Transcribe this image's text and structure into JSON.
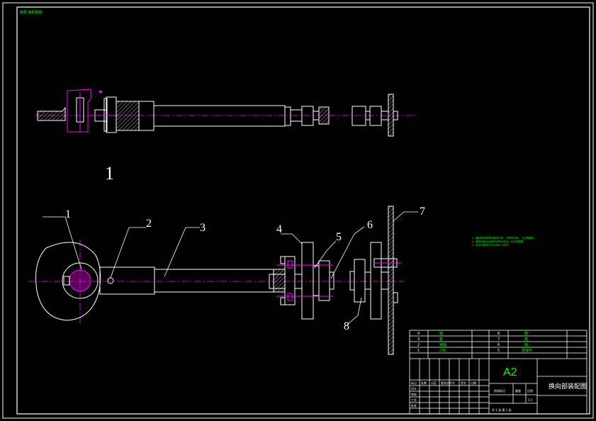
{
  "header": {
    "title_tag": "装配-装配图纸"
  },
  "view_label": "1",
  "part_callouts": [
    "1",
    "2",
    "3",
    "4",
    "5",
    "6",
    "7",
    "8"
  ],
  "tech_notes": [
    "1. 装配前所有零件清洗干净，不得有毛刺、飞边等缺陷",
    "2. 装配后各运动部件应转动灵活，无卡滞现象",
    "3. 未注公差按GB/T1804-m执行"
  ],
  "bom": [
    {
      "no": "4",
      "name": "轴"
    },
    {
      "no": "3",
      "name": "套"
    },
    {
      "no": "2",
      "name": "销轴"
    },
    {
      "no": "1",
      "name": "凸轮"
    },
    {
      "no": "8",
      "name": "键"
    },
    {
      "no": "7",
      "name": "盘"
    },
    {
      "no": "6",
      "name": "轴"
    },
    {
      "no": "5",
      "name": "连接件"
    }
  ],
  "title_block": {
    "sheet_size": "A2",
    "drawing_title": "换向部装配图",
    "rows": [
      "标记",
      "设计",
      "审核",
      "工艺",
      "批准"
    ],
    "cols": [
      "处数",
      "分区",
      "更改文件号",
      "签名",
      "日期"
    ],
    "stage": "阶段标记",
    "weight": "重量",
    "scale": "比例",
    "scale_value": "1:1",
    "sheets": "共 1 张 第 1 张"
  },
  "colors": {
    "outline": "#ffffff",
    "centerline": "#ff00ff",
    "leader": "#ffffff",
    "callout": "#00ff00",
    "note": "#00ff00",
    "hatch": "#ffffff"
  }
}
